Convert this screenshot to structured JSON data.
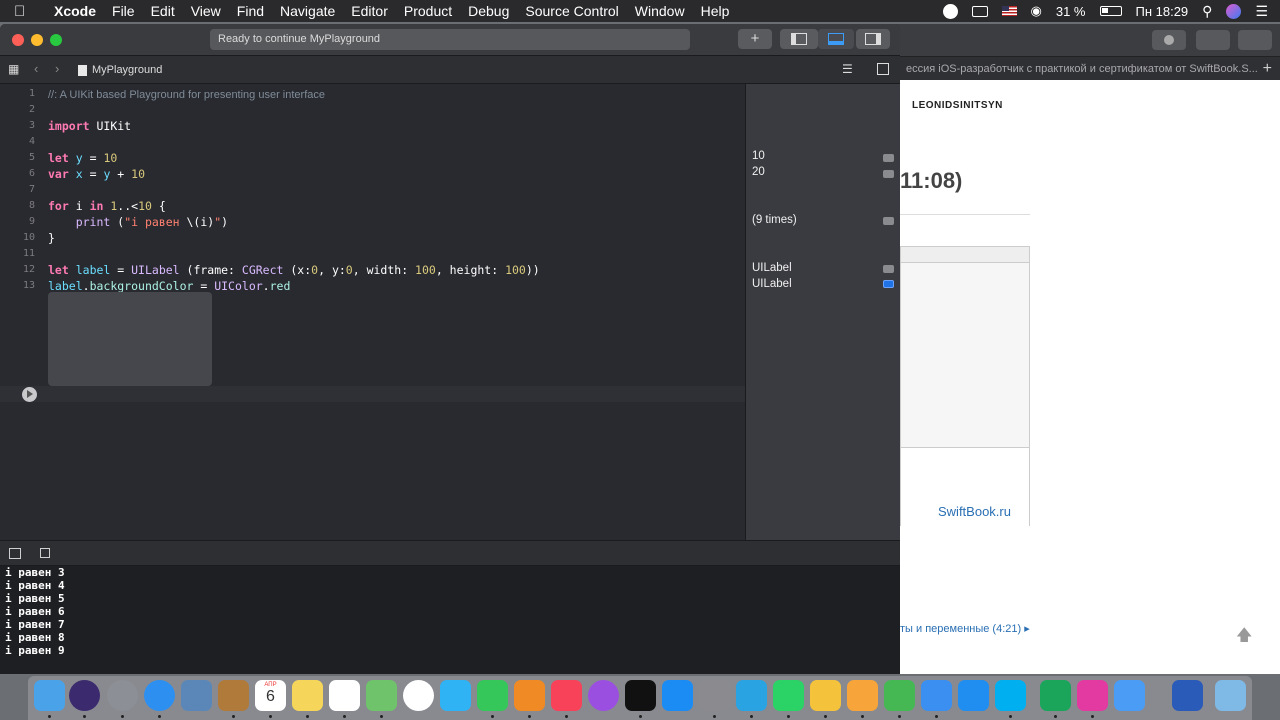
{
  "menubar": {
    "app_name": "Xcode",
    "items": [
      "File",
      "Edit",
      "View",
      "Find",
      "Navigate",
      "Editor",
      "Product",
      "Debug",
      "Source Control",
      "Window",
      "Help"
    ],
    "battery": "31 %",
    "clock": "Пн 18:29",
    "status_icons": [
      "vpn-icon",
      "airplay-icon",
      "us-flag-icon",
      "wifi-icon",
      "battery-icon",
      "spotlight-icon",
      "siri-icon",
      "notification-center-icon"
    ]
  },
  "window": {
    "status": "Ready to continue MyPlayground",
    "add_button": "+",
    "breadcrumb": "MyPlayground"
  },
  "editor": {
    "line_numbers": [
      "1",
      "2",
      "3",
      "4",
      "5",
      "6",
      "7",
      "8",
      "9",
      "10",
      "11",
      "12",
      "13"
    ]
  },
  "results": {
    "items": [
      {
        "line": 5,
        "value": "10"
      },
      {
        "line": 6,
        "value": "20"
      },
      {
        "line": 9,
        "value": "(9 times)"
      },
      {
        "line": 12,
        "value": "UILabel"
      },
      {
        "line": 13,
        "value": "UILabel"
      }
    ]
  },
  "console": {
    "lines": [
      "i равен 3",
      "i равен 4",
      "i равен 5",
      "i равен 6",
      "i равен 7",
      "i равен 8",
      "i равен 9"
    ]
  },
  "background_page": {
    "tab_title": "ессия iOS-разработчик с практикой и сертификатом от SwiftBook.S...",
    "author": "LEONIDSINITSYN",
    "time": "11:08)",
    "brand": "SwiftBook.ru",
    "lesson_link": "ты и переменные (4:21)"
  },
  "dock": {
    "calendar_month": "АПР",
    "calendar_day": "6",
    "apps": [
      "finder-icon",
      "siri-icon",
      "launchpad-icon",
      "safari-icon",
      "preview-icon",
      "contacts-icon",
      "calendar-icon",
      "notes-icon",
      "reminders-icon",
      "maps-icon",
      "photos-icon",
      "messages-icon",
      "facetime-icon",
      "books-icon",
      "music-icon",
      "podcasts-icon",
      "apple-tv-icon",
      "app-store-icon",
      "system-preferences-icon",
      "telegram-icon",
      "whatsapp-icon",
      "tips-icon",
      "pages-icon",
      "numbers-icon",
      "keynote-icon",
      "app-icon",
      "skype-icon",
      "cleanmymac-icon",
      "xcode-icon",
      "word-icon",
      "downloads-folder-icon",
      "trash-icon"
    ]
  },
  "colors": {
    "editor_bg": "#292a30",
    "keyword": "#ff7ab2",
    "variable": "#6bdfff",
    "number": "#d9c97c",
    "string": "#ff8170",
    "type": "#dabaff",
    "property": "#acf2e4",
    "comment": "#7f8c98"
  }
}
